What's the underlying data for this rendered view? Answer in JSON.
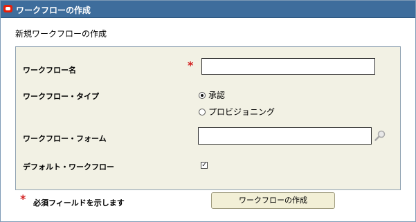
{
  "window": {
    "title": "ワークフローの作成"
  },
  "page": {
    "section_title": "新規ワークフローの作成"
  },
  "form": {
    "name": {
      "label": "ワークフロー名",
      "required_mark": "*",
      "value": ""
    },
    "type": {
      "label": "ワークフロー・タイプ",
      "options": [
        {
          "label": "承認",
          "selected": true
        },
        {
          "label": "プロビジョニング",
          "selected": false
        }
      ]
    },
    "form_field": {
      "label": "ワークフロー・フォーム",
      "value": "",
      "icon": "search-icon"
    },
    "default": {
      "label": "デフォルト・ワークフロー",
      "checked": true,
      "check_glyph": "✓"
    }
  },
  "footer": {
    "required_mark": "*",
    "required_note": "必須フィールドを示します",
    "create_button_label": "ワークフローの作成"
  },
  "colors": {
    "titlebar": "#3e6d9c",
    "panel_bg": "#f2f1e4",
    "required": "#d21f1f",
    "button_bg": "#f2efd6"
  }
}
